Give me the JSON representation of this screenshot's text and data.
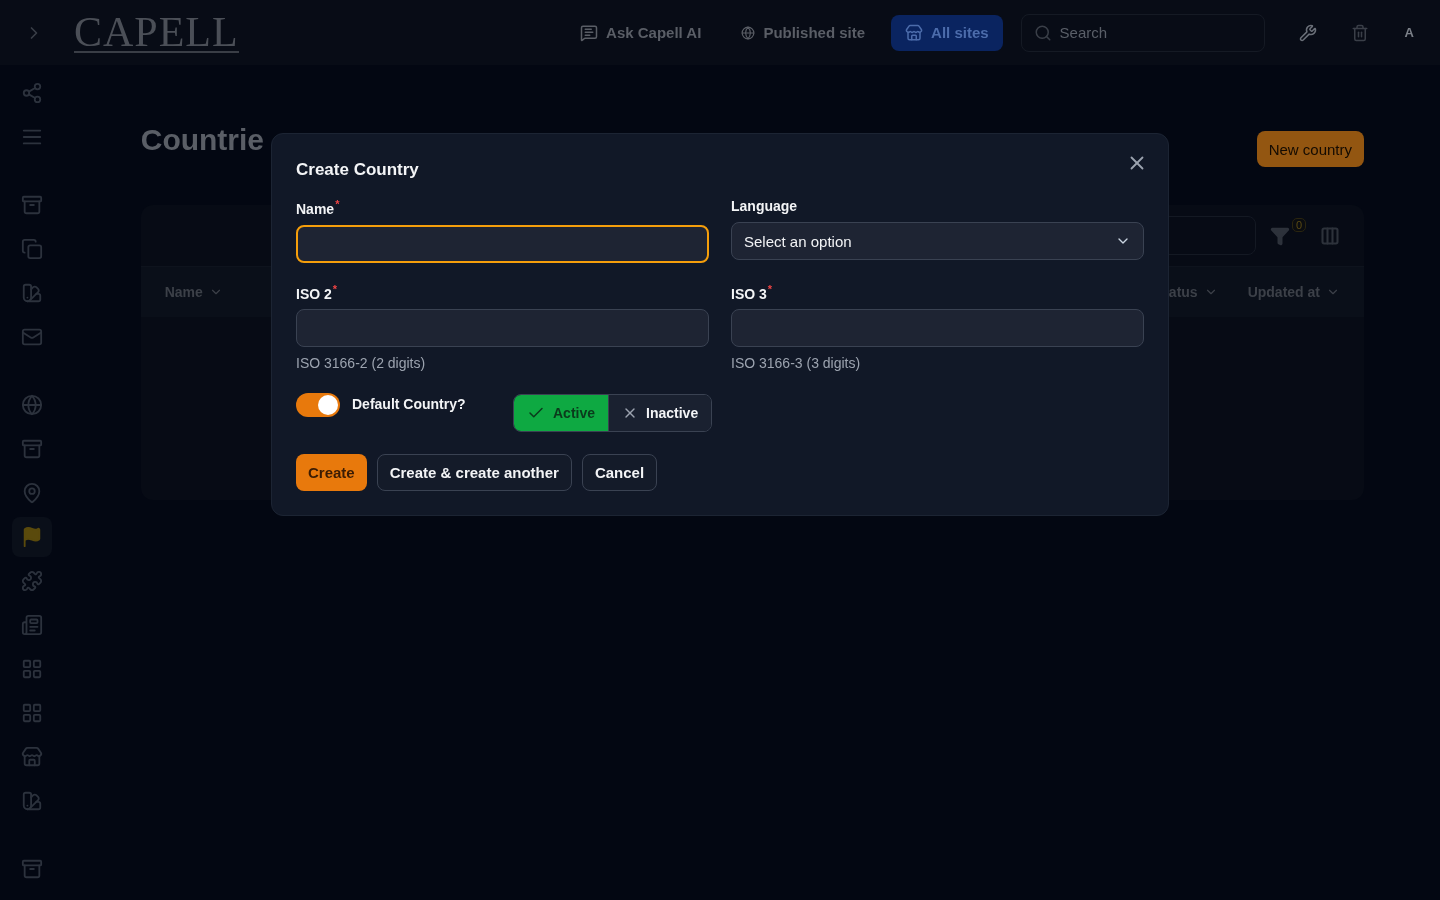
{
  "topbar": {
    "logo": "CAPELL",
    "links": [
      {
        "label": "Ask Capell AI",
        "selected": false
      },
      {
        "label": "Published site",
        "selected": false
      },
      {
        "label": "All sites",
        "selected": true
      }
    ],
    "search": {
      "placeholder": "Search"
    },
    "avatar": "A"
  },
  "sidebar": {
    "items": [
      {
        "selected": false
      },
      {
        "selected": false
      },
      {
        "selected": false
      },
      {
        "selected": false
      },
      {
        "selected": false
      },
      {
        "selected": false
      },
      {
        "selected": false
      },
      {
        "selected": false
      },
      {
        "selected": false
      },
      {
        "selected": true
      },
      {
        "selected": false
      },
      {
        "selected": false
      },
      {
        "selected": false
      },
      {
        "selected": false
      },
      {
        "selected": false
      },
      {
        "selected": false
      },
      {
        "selected": false
      }
    ]
  },
  "page": {
    "title": "Countrie",
    "new_button": "New country",
    "filter_count": "0",
    "columns": [
      "Name",
      "atus",
      "Updated at"
    ]
  },
  "modal": {
    "title": "Create Country",
    "fields": [
      {
        "label": "Name",
        "required_mark": "*",
        "kind": "text",
        "focused": true
      },
      {
        "label": "Language",
        "kind": "select",
        "value": "Select an option",
        "focused": false
      },
      {
        "label": "ISO 2",
        "required_mark": "*",
        "kind": "text",
        "hint": "ISO 3166-2 (2 digits)",
        "focused": false
      },
      {
        "label": "ISO 3",
        "required_mark": "*",
        "kind": "text",
        "hint": "ISO 3166-3 (3 digits)",
        "focused": false
      }
    ],
    "default_toggle": {
      "label": "Default Country?",
      "on": true
    },
    "status_options": [
      {
        "label": "Active",
        "selected": true
      },
      {
        "label": "Inactive",
        "selected": false
      }
    ],
    "buttons": [
      {
        "label": "Create",
        "kind": "primary"
      },
      {
        "label": "Create & create another",
        "kind": "secondary"
      },
      {
        "label": "Cancel",
        "kind": "secondary"
      }
    ]
  }
}
